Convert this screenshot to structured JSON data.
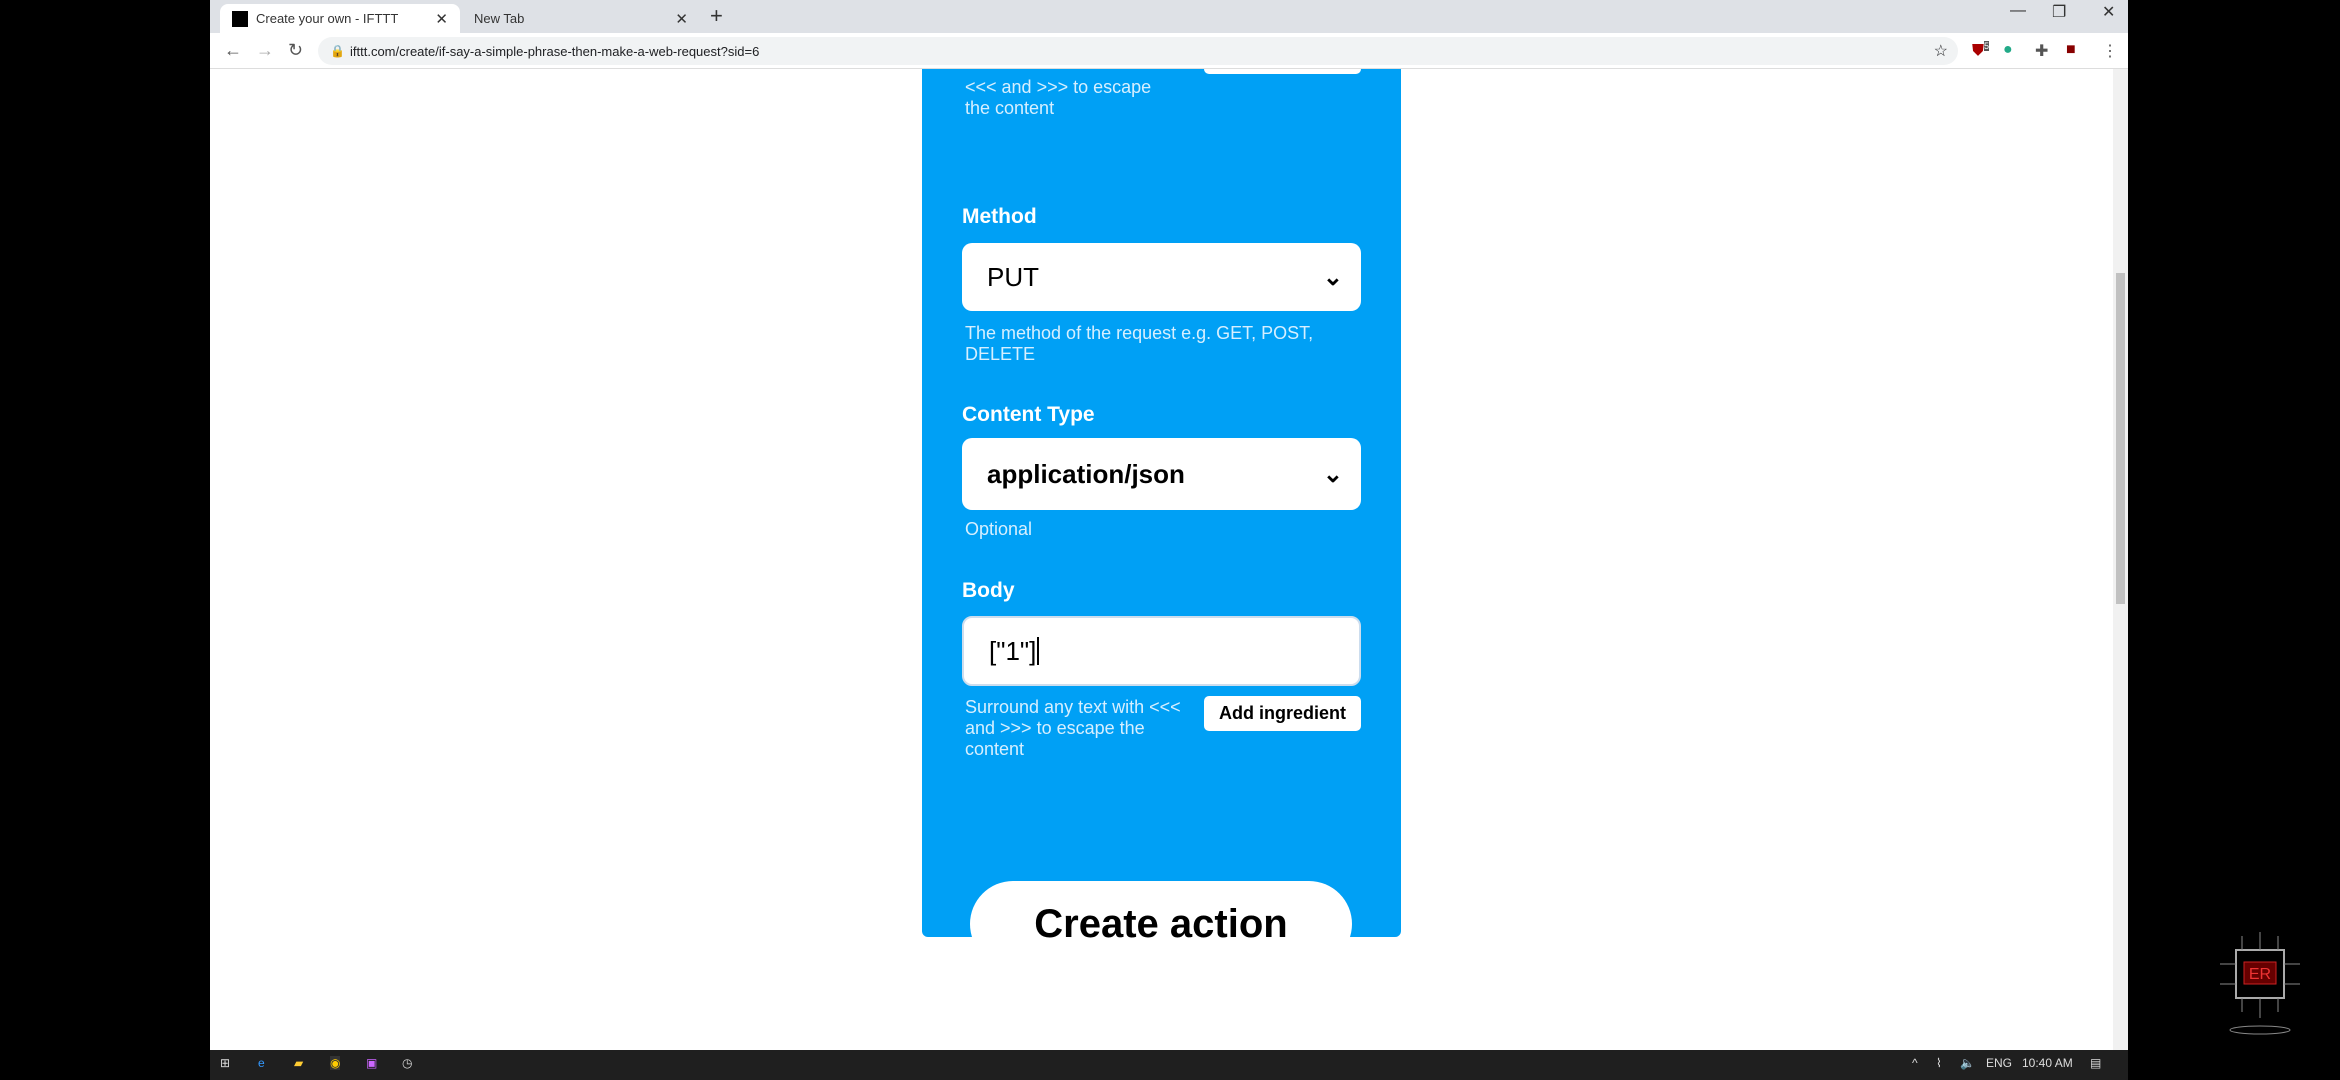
{
  "browser": {
    "tabs": [
      {
        "title": "Create your own - IFTTT",
        "active": true
      },
      {
        "title": "New Tab",
        "active": false
      }
    ],
    "url": "ifttt.com/create/if-say-a-simple-phrase-then-make-a-web-request?sid=6",
    "extension_badge": "5"
  },
  "form": {
    "prev_help": [
      "<<< and >>> to escape",
      "the content"
    ],
    "method": {
      "label": "Method",
      "value": "PUT",
      "help": "The method of the request e.g. GET, POST, DELETE"
    },
    "content_type": {
      "label": "Content Type",
      "value": "application/json",
      "help": "Optional"
    },
    "body": {
      "label": "Body",
      "value": "[\"1\"]",
      "help": "Surround any text with <<< and >>> to escape the content",
      "add_ingredient": "Add ingredient"
    },
    "create_button": "Create action"
  },
  "colors": {
    "panel": "#00a0f5"
  },
  "taskbar": {
    "lang": "ENG",
    "time": "10:40 AM"
  },
  "watermark": "ER"
}
